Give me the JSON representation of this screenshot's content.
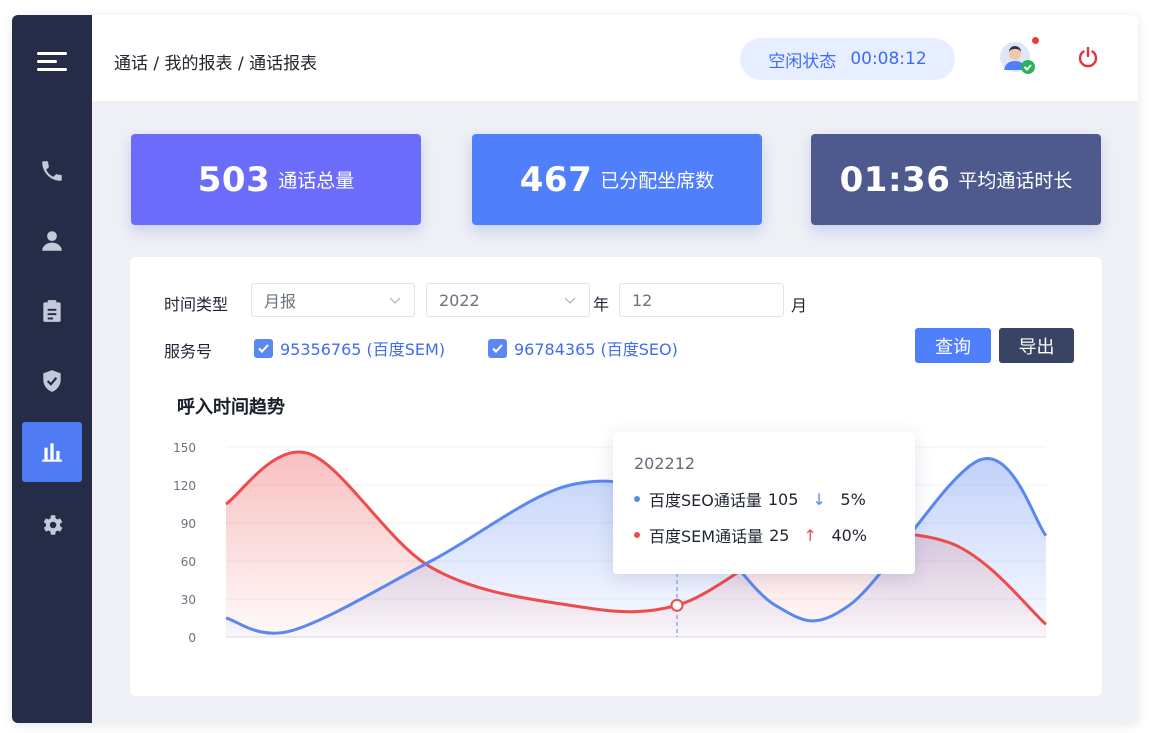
{
  "sidebar": {
    "items": [
      {
        "icon": "phone-icon",
        "active": false
      },
      {
        "icon": "user-icon",
        "active": false
      },
      {
        "icon": "clipboard-icon",
        "active": false
      },
      {
        "icon": "shield-check-icon",
        "active": false
      },
      {
        "icon": "bar-chart-icon",
        "active": true
      },
      {
        "icon": "gear-icon",
        "active": false
      }
    ]
  },
  "header": {
    "breadcrumb": [
      "通话",
      "我的报表",
      "通话报表"
    ],
    "breadcrumb_separator": " / ",
    "status_label": "空闲状态",
    "status_timer": "00:08:12"
  },
  "stats": [
    {
      "value": "503",
      "label": "通话总量",
      "color": "#6c6cfb"
    },
    {
      "value": "467",
      "label": "已分配坐席数",
      "color": "#4f7ffb"
    },
    {
      "value": "01:36",
      "label": "平均通话时长",
      "color": "#4e5a8d"
    }
  ],
  "filters": {
    "time_type_label": "时间类型",
    "time_type_value": "月报",
    "year_value": "2022",
    "year_unit": "年",
    "month_value": "12",
    "month_unit": "月",
    "service_label": "服务号",
    "services": [
      {
        "label": "95356765 (百度SEM)",
        "checked": true
      },
      {
        "label": "96784365 (百度SEO)",
        "checked": true
      }
    ],
    "query_label": "查询",
    "export_label": "导出"
  },
  "chart_title": "呼入时间趋势",
  "chart_data": {
    "type": "area",
    "yticks": [
      0,
      30,
      60,
      90,
      120,
      150
    ],
    "ylim": [
      0,
      150
    ],
    "grid": true,
    "series": [
      {
        "name": "百度SEO通话量",
        "color": "#5b87f0",
        "points": [
          [
            0,
            15
          ],
          [
            0.08,
            5
          ],
          [
            0.25,
            60
          ],
          [
            0.42,
            120
          ],
          [
            0.55,
            105
          ],
          [
            0.67,
            25
          ],
          [
            0.76,
            25
          ],
          [
            0.92,
            140
          ],
          [
            1,
            80
          ]
        ]
      },
      {
        "name": "百度SEM通话量",
        "color": "#ee4b4b",
        "points": [
          [
            0,
            105
          ],
          [
            0.1,
            145
          ],
          [
            0.25,
            55
          ],
          [
            0.42,
            25
          ],
          [
            0.55,
            25
          ],
          [
            0.7,
            75
          ],
          [
            0.88,
            75
          ],
          [
            1,
            10
          ]
        ]
      }
    ],
    "tooltip": {
      "title": "202212",
      "rows": [
        {
          "name": "百度SEO通话量",
          "value": "105",
          "arrow": "↓",
          "pct": "5%",
          "color": "#5b87f0",
          "arrow_color": "#5b87f0"
        },
        {
          "name": "百度SEM通话量",
          "value": "25",
          "arrow": "↑",
          "pct": "40%",
          "color": "#ee4b4b",
          "arrow_color": "#ee4b4b"
        }
      ]
    }
  }
}
